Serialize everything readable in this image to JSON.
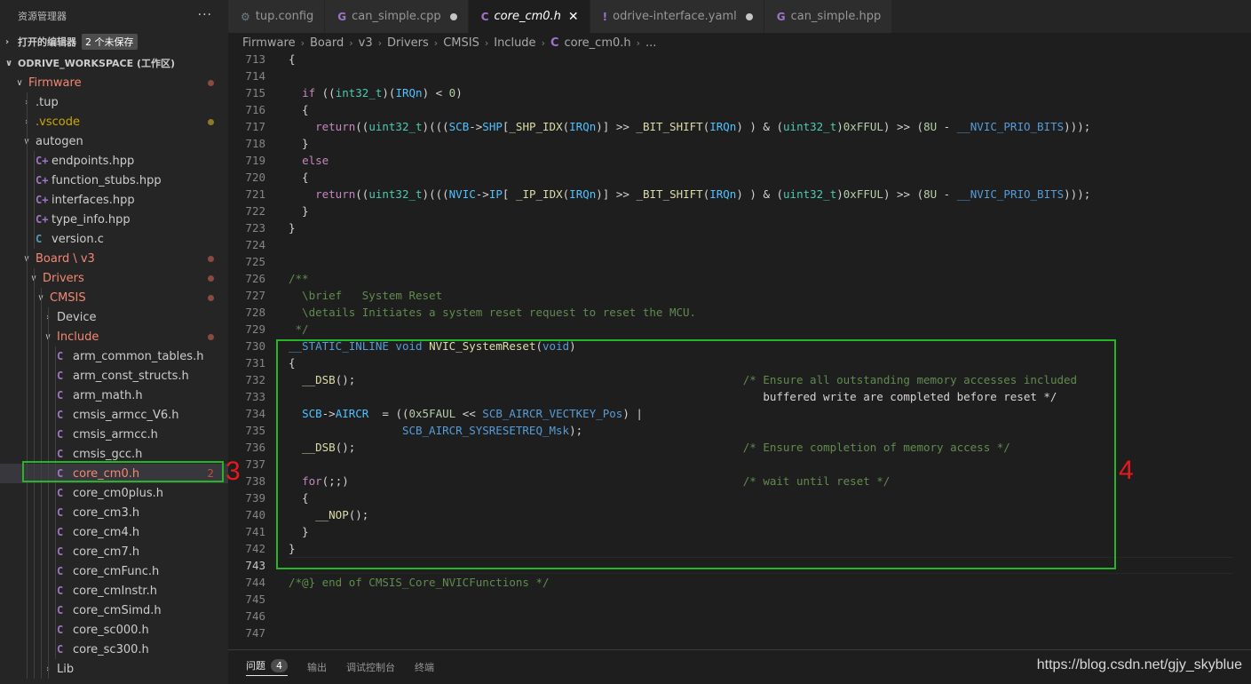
{
  "sidebar": {
    "title": "资源管理器",
    "more": "···",
    "open_editors": {
      "label": "打开的编辑器",
      "badge": "2 个未保存"
    },
    "workspace": {
      "label": "ODRIVE_WORKSPACE (工作区)"
    },
    "tree": [
      {
        "label": "Firmware",
        "chev": "∨",
        "icon": "",
        "modified": true
      },
      {
        "label": ".tup",
        "chev": "›",
        "icon": ""
      },
      {
        "label": ".vscode",
        "chev": "›",
        "icon": "",
        "warn": true
      },
      {
        "label": "autogen",
        "chev": "∨",
        "icon": ""
      },
      {
        "label": "endpoints.hpp",
        "icon": "C+"
      },
      {
        "label": "function_stubs.hpp",
        "icon": "C+"
      },
      {
        "label": "interfaces.hpp",
        "icon": "C+"
      },
      {
        "label": "type_info.hpp",
        "icon": "C+"
      },
      {
        "label": "version.c",
        "icon": "C"
      },
      {
        "label": "Board \\ v3",
        "chev": "∨",
        "icon": "",
        "modified": true
      },
      {
        "label": "Drivers",
        "chev": "∨",
        "icon": "",
        "modified": true
      },
      {
        "label": "CMSIS",
        "chev": "∨",
        "icon": "",
        "modified": true
      },
      {
        "label": "Device",
        "chev": "›",
        "icon": ""
      },
      {
        "label": "Include",
        "chev": "∨",
        "icon": "",
        "modified": true
      },
      {
        "label": "arm_common_tables.h",
        "icon": "C"
      },
      {
        "label": "arm_const_structs.h",
        "icon": "C"
      },
      {
        "label": "arm_math.h",
        "icon": "C"
      },
      {
        "label": "cmsis_armcc_V6.h",
        "icon": "C"
      },
      {
        "label": "cmsis_armcc.h",
        "icon": "C"
      },
      {
        "label": "cmsis_gcc.h",
        "icon": "C"
      },
      {
        "label": "core_cm0.h",
        "icon": "C",
        "count": "2"
      },
      {
        "label": "core_cm0plus.h",
        "icon": "C"
      },
      {
        "label": "core_cm3.h",
        "icon": "C"
      },
      {
        "label": "core_cm4.h",
        "icon": "C"
      },
      {
        "label": "core_cm7.h",
        "icon": "C"
      },
      {
        "label": "core_cmFunc.h",
        "icon": "C"
      },
      {
        "label": "core_cmInstr.h",
        "icon": "C"
      },
      {
        "label": "core_cmSimd.h",
        "icon": "C"
      },
      {
        "label": "core_sc000.h",
        "icon": "C"
      },
      {
        "label": "core_sc300.h",
        "icon": "C"
      },
      {
        "label": "Lib",
        "chev": "›",
        "icon": ""
      }
    ]
  },
  "tabs": [
    {
      "label": "tup.config",
      "icon": "gear-icon",
      "glyph": "⚙"
    },
    {
      "label": "can_simple.cpp",
      "icon": "cpp-file-icon",
      "glyph": "G",
      "modified": true
    },
    {
      "label": "core_cm0.h",
      "icon": "c-file-icon",
      "glyph": "C",
      "active": true,
      "close": "✕"
    },
    {
      "label": "odrive-interface.yaml",
      "icon": "yaml-file-icon",
      "glyph": "!",
      "modified": true
    },
    {
      "label": "can_simple.hpp",
      "icon": "cpp-file-icon",
      "glyph": "G"
    }
  ],
  "breadcrumb": [
    "Firmware",
    "Board",
    "v3",
    "Drivers",
    "CMSIS",
    "Include",
    "core_cm0.h",
    "..."
  ],
  "breadcrumb_sep": "›",
  "breadcrumb_file_icon": "C",
  "editor": {
    "lines": [
      {
        "n": "713",
        "code": "{"
      },
      {
        "n": "714",
        "code": ""
      },
      {
        "n": "715",
        "code": "  if ((int32_t)(IRQn) < 0)"
      },
      {
        "n": "716",
        "code": "  {"
      },
      {
        "n": "717",
        "code": "    return((uint32_t)(((SCB->SHP[_SHP_IDX(IRQn)] >> _BIT_SHIFT(IRQn) ) & (uint32_t)0xFFUL) >> (8U - __NVIC_PRIO_BITS)));"
      },
      {
        "n": "718",
        "code": "  }"
      },
      {
        "n": "719",
        "code": "  else"
      },
      {
        "n": "720",
        "code": "  {"
      },
      {
        "n": "721",
        "code": "    return((uint32_t)(((NVIC->IP[ _IP_IDX(IRQn)] >> _BIT_SHIFT(IRQn) ) & (uint32_t)0xFFUL) >> (8U - __NVIC_PRIO_BITS)));"
      },
      {
        "n": "722",
        "code": "  }"
      },
      {
        "n": "723",
        "code": "}"
      },
      {
        "n": "724",
        "code": ""
      },
      {
        "n": "725",
        "code": ""
      },
      {
        "n": "726",
        "code": "/**"
      },
      {
        "n": "727",
        "code": "  \\brief   System Reset"
      },
      {
        "n": "728",
        "code": "  \\details Initiates a system reset request to reset the MCU."
      },
      {
        "n": "729",
        "code": " */"
      },
      {
        "n": "730",
        "code": "__STATIC_INLINE void NVIC_SystemReset(void)"
      },
      {
        "n": "731",
        "code": "{"
      },
      {
        "n": "732",
        "code": "  __DSB();                                                          /* Ensure all outstanding memory accesses included"
      },
      {
        "n": "733",
        "code": "                                                                       buffered write are completed before reset */"
      },
      {
        "n": "734",
        "code": "  SCB->AIRCR  = ((0x5FAUL << SCB_AIRCR_VECTKEY_Pos) |"
      },
      {
        "n": "735",
        "code": "                 SCB_AIRCR_SYSRESETREQ_Msk);"
      },
      {
        "n": "736",
        "code": "  __DSB();                                                          /* Ensure completion of memory access */"
      },
      {
        "n": "737",
        "code": ""
      },
      {
        "n": "738",
        "code": "  for(;;)                                                           /* wait until reset */"
      },
      {
        "n": "739",
        "code": "  {"
      },
      {
        "n": "740",
        "code": "    __NOP();"
      },
      {
        "n": "741",
        "code": "  }"
      },
      {
        "n": "742",
        "code": "}"
      },
      {
        "n": "743",
        "code": "",
        "current": true
      },
      {
        "n": "744",
        "code": "/*@} end of CMSIS_Core_NVICFunctions */"
      },
      {
        "n": "745",
        "code": ""
      },
      {
        "n": "746",
        "code": ""
      },
      {
        "n": "747",
        "code": ""
      }
    ]
  },
  "annotations": {
    "sidebar_marker": "3",
    "editor_marker": "4",
    "color": "#28b428",
    "num_color": "#e8191c"
  },
  "panel": {
    "tabs": [
      {
        "label": "问题",
        "count": "4",
        "active": true
      },
      {
        "label": "输出"
      },
      {
        "label": "调试控制台"
      },
      {
        "label": "终端"
      }
    ]
  },
  "watermark": "https://blog.csdn.net/gjy_skyblue",
  "colors": {
    "modified": "#f48771",
    "c_icon": "#a074c4",
    "accent_tab": "#1e1e1e",
    "sidebar_bg": "#252526",
    "editor_bg": "#1e1e1e"
  }
}
